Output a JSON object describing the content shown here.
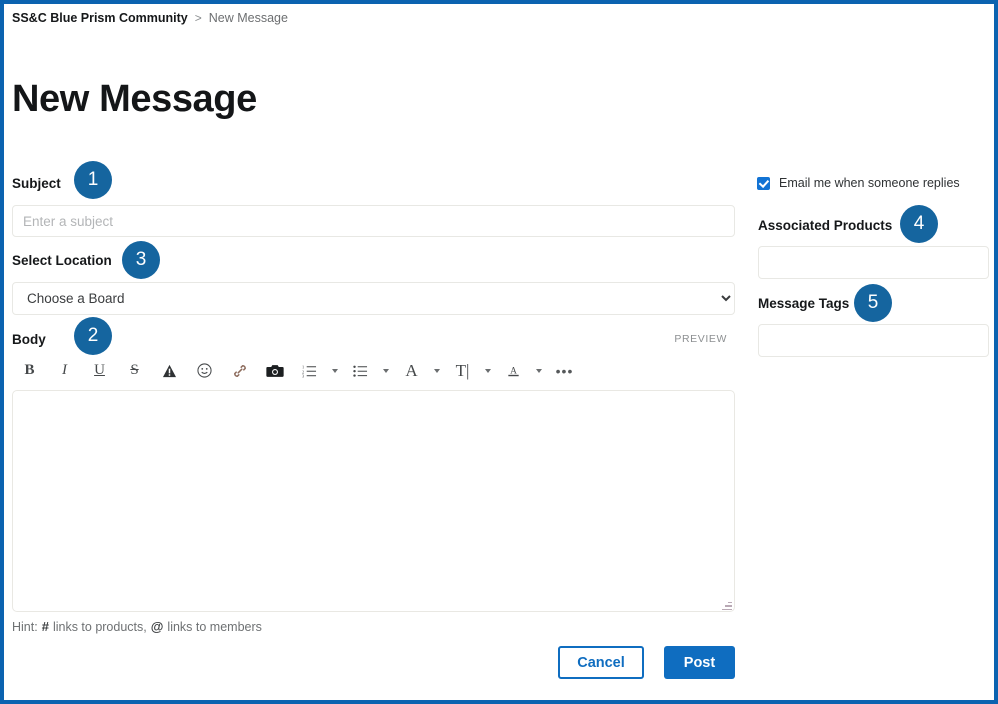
{
  "breadcrumb": {
    "root": "SS&C Blue Prism Community",
    "separator": ">",
    "current": "New Message"
  },
  "page_title": "New Message",
  "form": {
    "subject": {
      "label": "Subject",
      "placeholder": "Enter a subject",
      "value": ""
    },
    "location": {
      "label": "Select Location",
      "selected": "Choose a Board",
      "options": [
        "Choose a Board"
      ]
    },
    "body": {
      "label": "Body",
      "preview_label": "PREVIEW",
      "value": "",
      "hint_prefix": "Hint:",
      "hint_hash": "#",
      "hint_hash_text": "links to products,",
      "hint_at": "@",
      "hint_at_text": "links to members"
    }
  },
  "toolbar": {
    "items": [
      {
        "name": "bold-icon",
        "glyph": "B"
      },
      {
        "name": "italic-icon",
        "glyph": "I"
      },
      {
        "name": "underline-icon",
        "glyph": "U"
      },
      {
        "name": "strikethrough-icon",
        "glyph": "S"
      },
      {
        "name": "highlight-warning-icon",
        "glyph": ""
      },
      {
        "name": "emoji-icon",
        "glyph": ""
      },
      {
        "name": "link-icon",
        "glyph": ""
      },
      {
        "name": "camera-icon",
        "glyph": ""
      },
      {
        "name": "numbered-list-icon",
        "glyph": ""
      },
      {
        "name": "bullet-list-icon",
        "glyph": ""
      },
      {
        "name": "font-family-icon",
        "glyph": "A"
      },
      {
        "name": "text-size-icon",
        "glyph": "T|"
      },
      {
        "name": "text-color-icon",
        "glyph": "A"
      },
      {
        "name": "more-options-icon",
        "glyph": "•••"
      }
    ]
  },
  "sidebar": {
    "email_checkbox": {
      "label": "Email me when someone replies",
      "checked": true
    },
    "associated_products": {
      "label": "Associated Products",
      "value": ""
    },
    "message_tags": {
      "label": "Message Tags",
      "value": ""
    }
  },
  "actions": {
    "cancel_label": "Cancel",
    "post_label": "Post"
  },
  "badges": {
    "one": "1",
    "two": "2",
    "three": "3",
    "four": "4",
    "five": "5"
  },
  "colors": {
    "frame_border": "#0b63b0",
    "badge_blue": "#15659f",
    "primary_blue": "#0f6dc0",
    "checkbox_blue": "#1273d4"
  }
}
